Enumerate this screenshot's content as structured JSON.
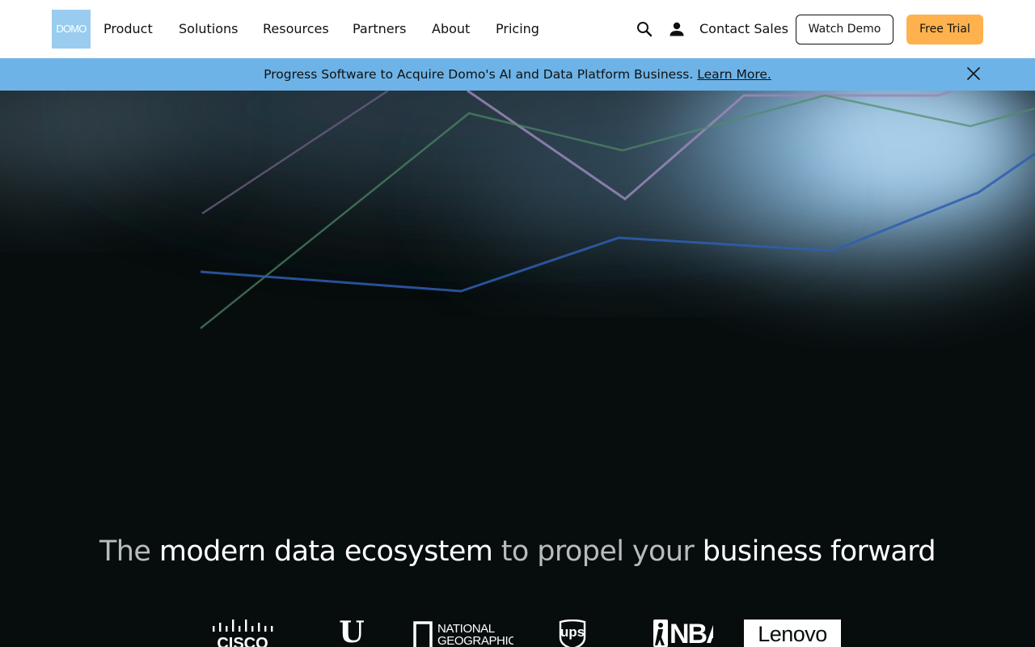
{
  "nav": {
    "logo_text": "DOMO",
    "items": [
      {
        "label": "Product"
      },
      {
        "label": "Solutions"
      },
      {
        "label": "Resources"
      },
      {
        "label": "Partners"
      },
      {
        "label": "About"
      },
      {
        "label": "Pricing"
      }
    ],
    "search_icon": "search-icon",
    "account_icon": "user-icon",
    "contact_sales": "Contact Sales",
    "watch_demo": "Watch Demo",
    "free_trial": "Free Trial"
  },
  "banner": {
    "text": "Progress Software to Acquire Domo's AI and Data Platform Business.",
    "link": "Learn More.",
    "close_icon": "close-icon"
  },
  "hero": {
    "headline": {
      "part1": "The ",
      "part2": "modern data ecosystem",
      "part3": " to propel your ",
      "part4": "business forward"
    }
  },
  "logos": {
    "cisco": "CISCO",
    "unilever": "U",
    "natgeo_line1": "NATIONAL",
    "natgeo_line2": "GEOGRAPHIC",
    "ups": "ups",
    "nba": "NBA",
    "lenovo": "Lenovo"
  },
  "colors": {
    "accent_orange": "#ffb14d",
    "banner_blue": "#6db3e7",
    "logo_blue": "#99ccee",
    "hero_bg": "#070d0d"
  }
}
